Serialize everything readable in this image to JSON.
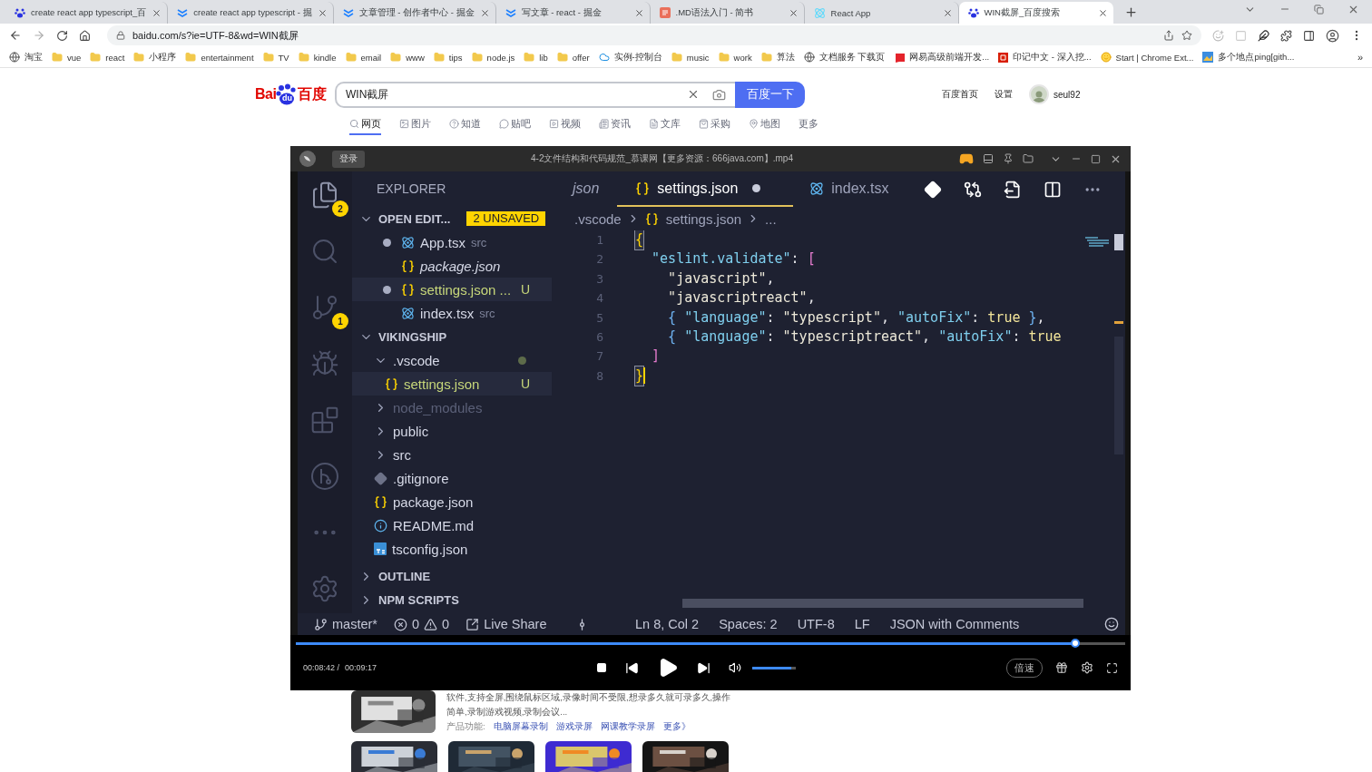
{
  "browser": {
    "tabs": [
      {
        "title": "create react app typescript_百",
        "selected": false
      },
      {
        "title": "create react app typescript - 掘",
        "selected": false
      },
      {
        "title": "文章管理 - 创作者中心 - 掘金",
        "selected": false
      },
      {
        "title": "写文章 - react - 掘金",
        "selected": false
      },
      {
        "title": ".MD语法入门 - 简书",
        "selected": false
      },
      {
        "title": "React App",
        "selected": false
      },
      {
        "title": "WIN截屏_百度搜索",
        "selected": true
      }
    ],
    "address": "baidu.com/s?ie=UTF-8&wd=WIN截屏",
    "bookmarks": [
      "淘宝",
      "vue",
      "react",
      "小程序",
      "entertainment",
      "TV",
      "kindle",
      "email",
      "www",
      "tips",
      "node.js",
      "lib",
      "offer",
      "实例-控制台",
      "music",
      "work",
      "算法",
      "文档服务 下载页",
      "网易高级前端开发...",
      "印记中文 - 深入挖...",
      "Start | Chrome Ext...",
      "多个地点ping[gith..."
    ],
    "bookmarks_more": "»"
  },
  "baidu": {
    "logo": {
      "left": "Bai",
      "paw": "du",
      "right": "百度"
    },
    "search": {
      "value": "WIN截屏"
    },
    "submit": "百度一下",
    "links": [
      "百度首页",
      "设置"
    ],
    "user": "seul92",
    "nav": [
      {
        "label": "网页",
        "selected": true
      },
      {
        "label": "图片",
        "selected": false
      },
      {
        "label": "知道",
        "selected": false
      },
      {
        "label": "贴吧",
        "selected": false
      },
      {
        "label": "视频",
        "selected": false
      },
      {
        "label": "资讯",
        "selected": false
      },
      {
        "label": "文库",
        "selected": false
      },
      {
        "label": "采购",
        "selected": false
      },
      {
        "label": "地图",
        "selected": false
      },
      {
        "label": "更多",
        "selected": false
      }
    ],
    "result": {
      "image": {
        "kind": "picture"
      },
      "snippet": [
        "软件,支持全屏,围绕鼠标区域,录像时间不受限,想录多久就可录多久,操作",
        "简单,录制游戏视频,录制会议..."
      ],
      "features_label": "产品功能:",
      "features": [
        "电脑屏幕录制",
        "游戏录屏",
        "网课教学录屏",
        "更多》"
      ],
      "thumbnails": [
        {
          "kind": "picture"
        },
        {
          "kind": "picture"
        },
        {
          "kind": "picture"
        },
        {
          "kind": "picture"
        }
      ]
    }
  },
  "player": {
    "login": "登录",
    "title": "4-2文件结构和代码规范_慕课网【更多资源：666java.com】.mp4",
    "elapsed": "00:08:42 /",
    "duration": "00:09:17",
    "volume": {
      "level": 0.9
    },
    "playing": false,
    "speed": "倍速"
  },
  "vscode": {
    "activity": [
      {
        "kind": "files",
        "badge": "2"
      },
      {
        "kind": "search"
      },
      {
        "kind": "scm",
        "badge": "1"
      },
      {
        "kind": "debug"
      },
      {
        "kind": "extensions"
      },
      {
        "kind": "git-graph"
      },
      {
        "kind": "more"
      },
      {
        "kind": "settings"
      }
    ],
    "sidebar": {
      "title": "EXPLORER",
      "sections": [
        {
          "label": "OPEN EDIT...",
          "badge": "2 UNSAVED",
          "expanded": true,
          "items": [
            {
              "name": "App.tsx",
              "detail": "src",
              "dirty": true,
              "italic": false,
              "selected": false
            },
            {
              "name": "package.json",
              "dirty": false,
              "italic": true,
              "selected": false
            },
            {
              "name": "settings.json ...",
              "dirty": true,
              "italic": false,
              "selected": true,
              "status": "U"
            },
            {
              "name": "index.tsx",
              "detail": "src",
              "dirty": false,
              "italic": false,
              "selected": false
            }
          ]
        },
        {
          "label": "VIKINGSHIP",
          "expanded": true,
          "items": [
            {
              "name": ".vscode",
              "expanded": true,
              "modified": true,
              "ignored": false,
              "selected": false,
              "children": [
                {
                  "name": "settings.json",
                  "status": "U",
                  "ignored": false,
                  "selected": true
                }
              ]
            },
            {
              "name": "node_modules",
              "expanded": false,
              "modified": false,
              "ignored": true,
              "selected": false
            },
            {
              "name": "public",
              "expanded": false,
              "modified": false,
              "ignored": false,
              "selected": false
            },
            {
              "name": "src",
              "expanded": false,
              "modified": false,
              "ignored": false,
              "selected": false
            },
            {
              "name": ".gitignore",
              "ignored": false,
              "selected": false
            },
            {
              "name": "package.json",
              "ignored": false,
              "selected": false
            },
            {
              "name": "README.md",
              "ignored": false,
              "selected": false
            },
            {
              "name": "tsconfig.json",
              "ignored": false,
              "selected": false
            }
          ]
        },
        {
          "label": "OUTLINE",
          "expanded": false
        },
        {
          "label": "NPM SCRIPTS",
          "expanded": false
        }
      ]
    },
    "tabs": [
      {
        "label": "json",
        "italic": true,
        "selected": false,
        "dirty": false
      },
      {
        "label": "settings.json",
        "italic": false,
        "selected": true,
        "dirty": true
      },
      {
        "label": "index.tsx",
        "italic": false,
        "selected": false,
        "dirty": false
      }
    ],
    "breadcrumb": [
      ".vscode",
      "settings.json",
      "..."
    ],
    "lines": [
      {
        "number": "1",
        "cursor": false,
        "tokens": [
          {
            "kind": "match",
            "text": "{"
          }
        ]
      },
      {
        "number": "2",
        "cursor": false,
        "tokens": [
          {
            "kind": "key",
            "text": "  \"eslint.validate\""
          },
          {
            "kind": "punct",
            "text": ": "
          },
          {
            "kind": "bracket",
            "text": "["
          }
        ]
      },
      {
        "number": "3",
        "cursor": false,
        "tokens": [
          {
            "kind": "string",
            "text": "    \"javascript\""
          },
          {
            "kind": "punct",
            "text": ","
          }
        ]
      },
      {
        "number": "4",
        "cursor": false,
        "tokens": [
          {
            "kind": "string",
            "text": "    \"javascriptreact\""
          },
          {
            "kind": "punct",
            "text": ","
          }
        ]
      },
      {
        "number": "5",
        "cursor": false,
        "tokens": [
          {
            "kind": "obj",
            "text": "    { "
          },
          {
            "kind": "key",
            "text": "\"language\""
          },
          {
            "kind": "punct",
            "text": ": "
          },
          {
            "kind": "string",
            "text": "\"typescript\""
          },
          {
            "kind": "punct",
            "text": ", "
          },
          {
            "kind": "key",
            "text": "\"autoFix\""
          },
          {
            "kind": "punct",
            "text": ": "
          },
          {
            "kind": "bool",
            "text": "true"
          },
          {
            "kind": "obj",
            "text": " }"
          },
          {
            "kind": "punct",
            "text": ","
          }
        ]
      },
      {
        "number": "6",
        "cursor": false,
        "tokens": [
          {
            "kind": "obj",
            "text": "    { "
          },
          {
            "kind": "key",
            "text": "\"language\""
          },
          {
            "kind": "punct",
            "text": ": "
          },
          {
            "kind": "string",
            "text": "\"typescriptreact\""
          },
          {
            "kind": "punct",
            "text": ", "
          },
          {
            "kind": "key",
            "text": "\"autoFix\""
          },
          {
            "kind": "punct",
            "text": ": "
          },
          {
            "kind": "bool",
            "text": "true"
          }
        ]
      },
      {
        "number": "7",
        "cursor": false,
        "tokens": [
          {
            "kind": "bracket",
            "text": "  ]"
          }
        ]
      },
      {
        "number": "8",
        "cursor": true,
        "tokens": [
          {
            "kind": "match",
            "text": "}"
          }
        ]
      }
    ],
    "status": {
      "branch": "master*",
      "errors": "0",
      "warnings": "0",
      "live_share": "Live Share",
      "position": "Ln 8, Col 2",
      "spaces": "Spaces: 2",
      "encoding": "UTF-8",
      "eol": "LF",
      "language": "JSON with Comments"
    }
  }
}
